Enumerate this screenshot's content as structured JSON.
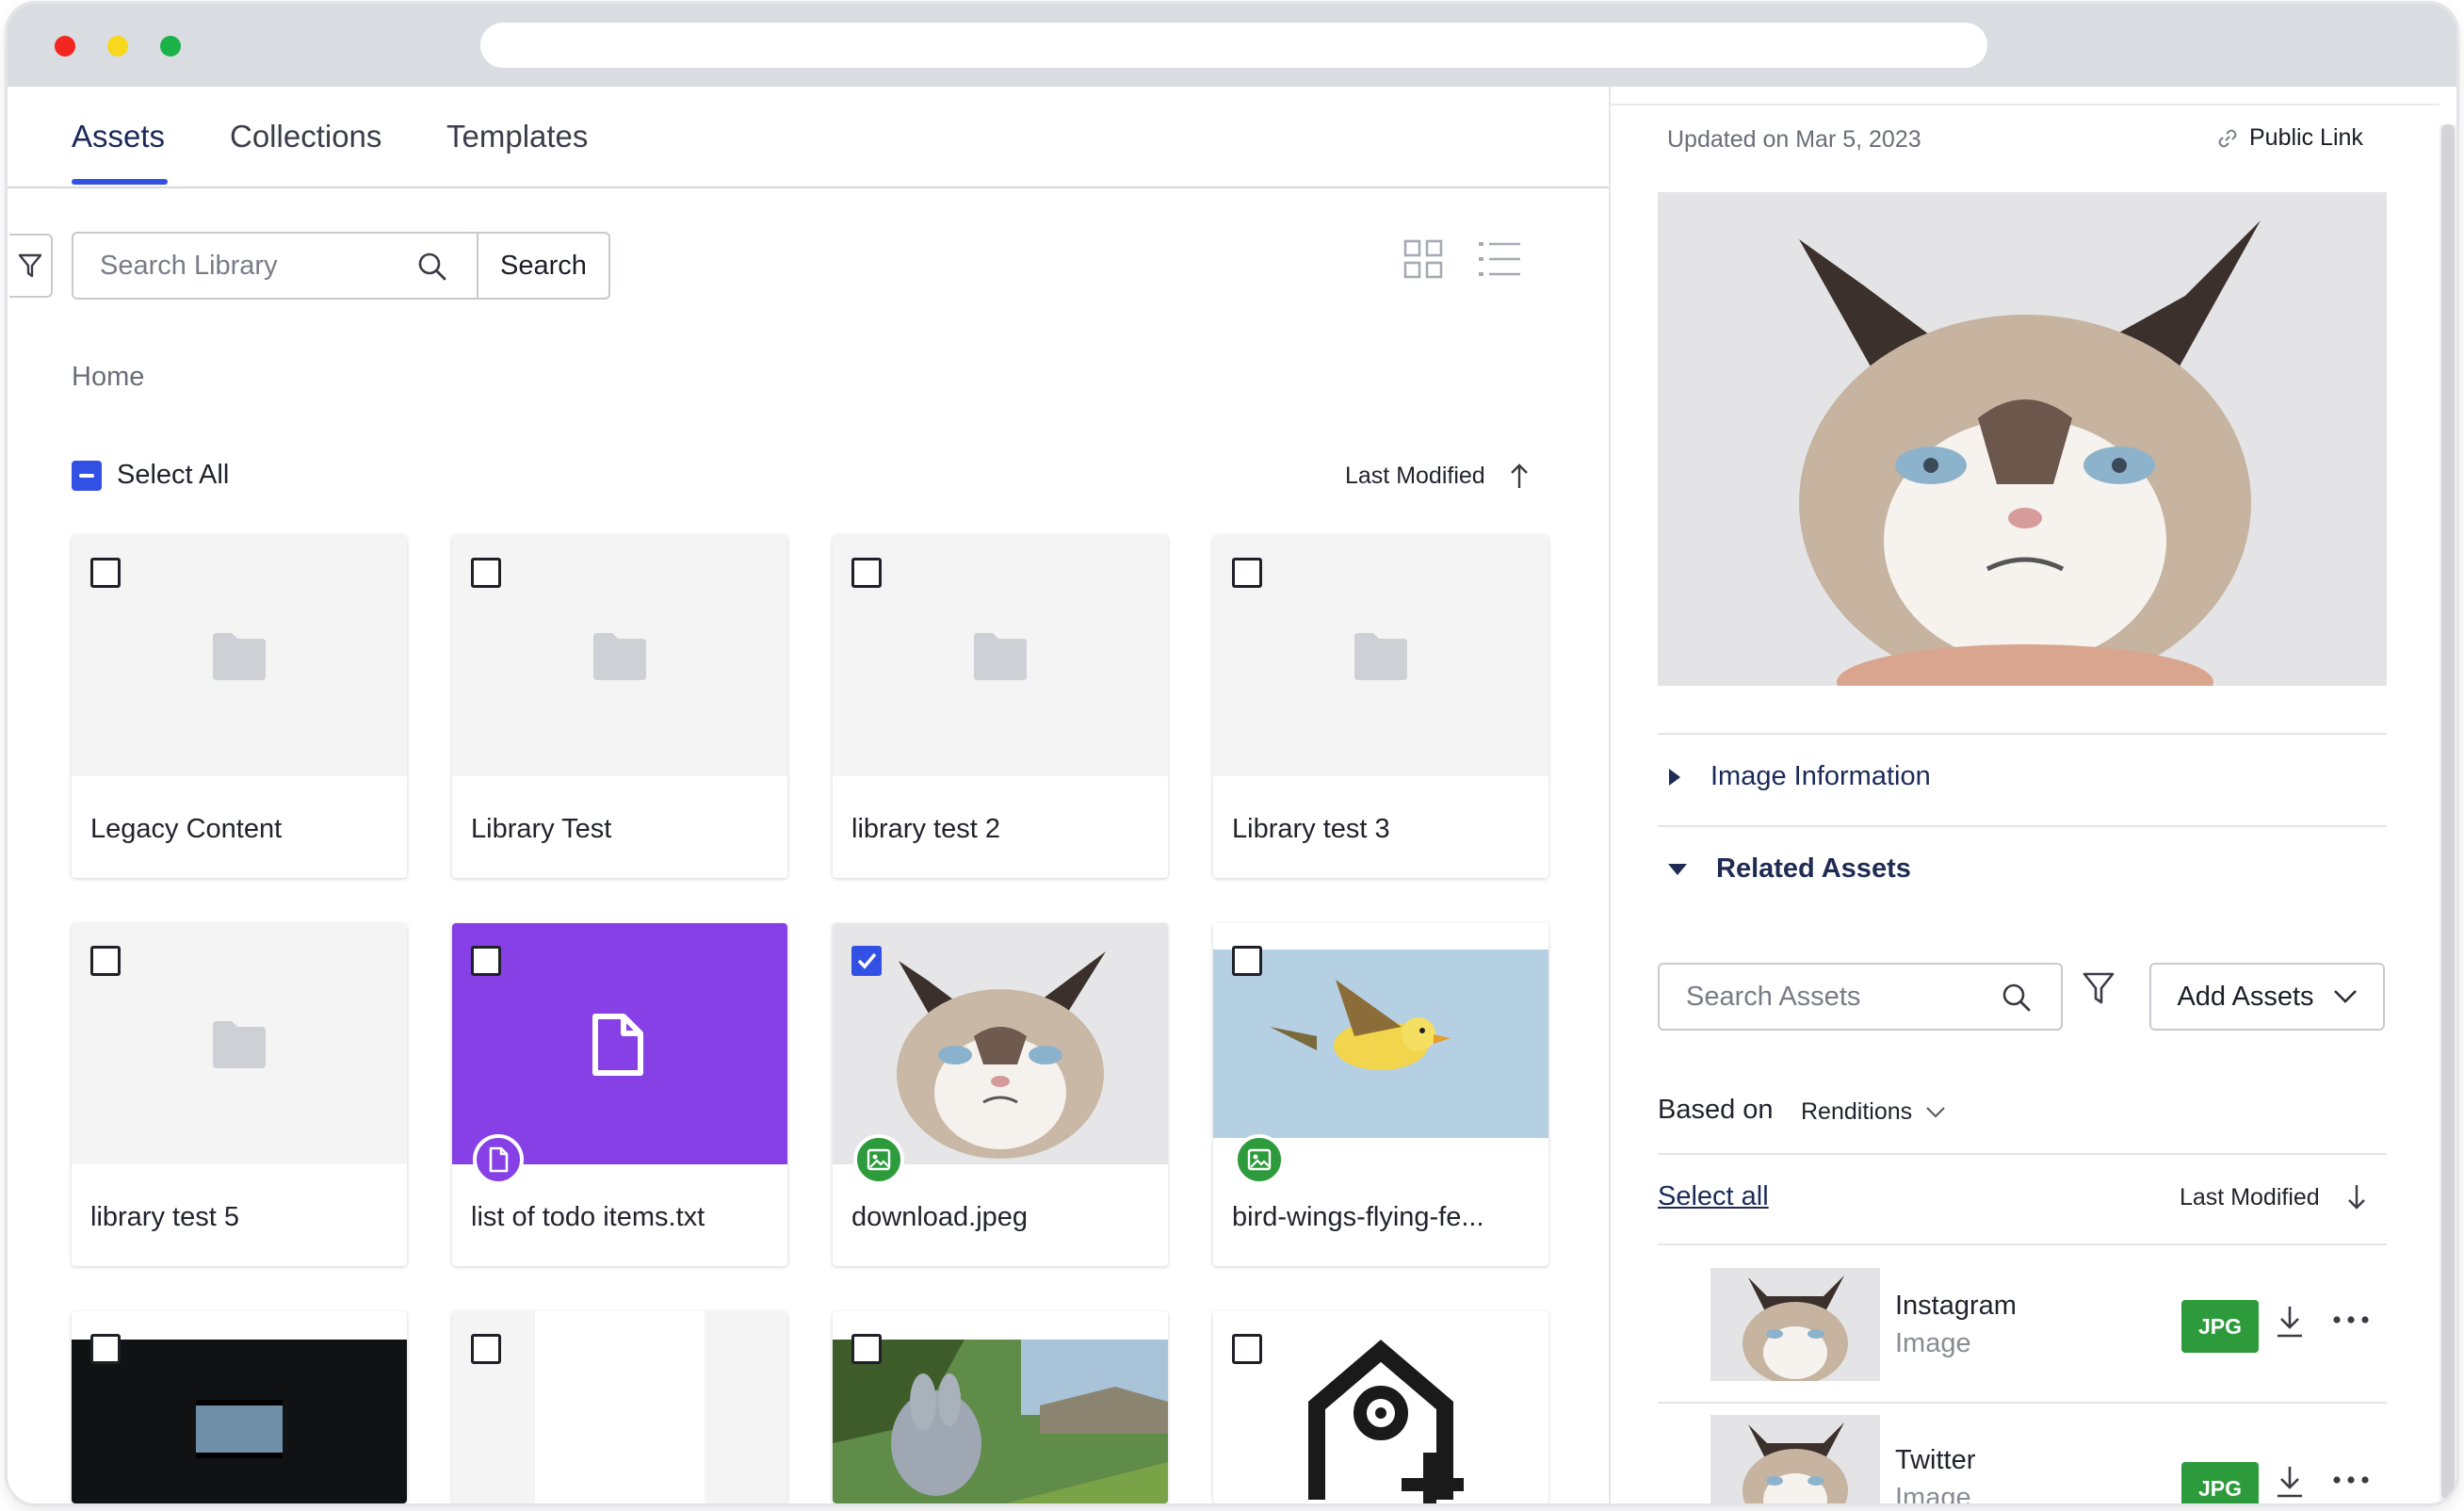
{
  "tabs": [
    {
      "label": "Assets",
      "active": true
    },
    {
      "label": "Collections",
      "active": false
    },
    {
      "label": "Templates",
      "active": false
    }
  ],
  "search": {
    "placeholder": "Search Library",
    "button_label": "Search"
  },
  "breadcrumb": "Home",
  "select_all_label": "Select All",
  "sort": {
    "label": "Last Modified",
    "direction": "ascending"
  },
  "cards": [
    {
      "name": "Legacy Content",
      "kind": "folder",
      "checked": false
    },
    {
      "name": "Library Test",
      "kind": "folder",
      "checked": false
    },
    {
      "name": "library test 2",
      "kind": "folder",
      "checked": false
    },
    {
      "name": "Library test 3",
      "kind": "folder",
      "checked": false
    },
    {
      "name": "library test 5",
      "kind": "folder",
      "checked": false
    },
    {
      "name": "list of todo items.txt",
      "kind": "document",
      "checked": false
    },
    {
      "name": "download.jpeg",
      "kind": "image",
      "checked": true
    },
    {
      "name": "bird-wings-flying-fe...",
      "kind": "image",
      "checked": false
    },
    {
      "name": "",
      "kind": "video",
      "checked": false
    },
    {
      "name": "",
      "kind": "blank",
      "checked": false
    },
    {
      "name": "",
      "kind": "image",
      "checked": false
    },
    {
      "name": "",
      "kind": "logo",
      "checked": false
    }
  ],
  "detail": {
    "updated": "Updated on Mar 5, 2023",
    "public_link": "Public Link",
    "sections": {
      "image_information": "Image Information",
      "related_assets": "Related Assets"
    },
    "assets_search_placeholder": "Search Assets",
    "add_assets_label": "Add Assets",
    "based_on_label": "Based on",
    "based_on_value": "Renditions",
    "select_all": "Select all",
    "sort_label": "Last Modified",
    "related": [
      {
        "name": "Instagram",
        "type": "Image",
        "format": "JPG"
      },
      {
        "name": "Twitter",
        "type": "Image",
        "format": "JPG"
      }
    ]
  },
  "colors": {
    "accent": "#3251e4",
    "doc_purple": "#8640e6",
    "jpg_green": "#2d9b3c"
  }
}
